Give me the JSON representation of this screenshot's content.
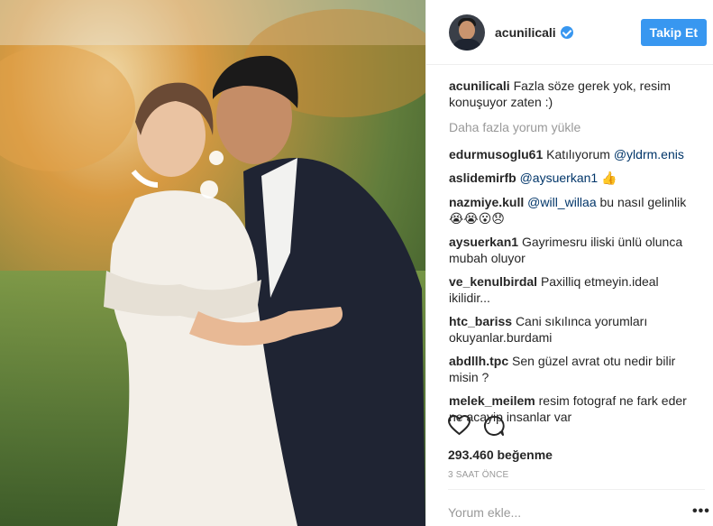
{
  "post": {
    "photo_alt": "Couple photo",
    "author": "acunilicali",
    "follow_label": "Takip Et",
    "caption_user": "acunilicali",
    "caption_text": "Fazla söze gerek yok, resim konuşuyor zaten :)",
    "load_more": "Daha fazla yorum yükle",
    "comments": [
      {
        "user": "edurmusoglu61",
        "text": "Katılıyorum ",
        "mention": "@yldrm.enis",
        "emoji": ""
      },
      {
        "user": "aslidemirfb",
        "text": "",
        "mention": "@aysuerkan1",
        "emoji": " 👍"
      },
      {
        "user": "nazmiye.kull",
        "text": "",
        "mention": "@will_willaa",
        "emoji": "",
        "after": " bu nasıl gelinlik 😭😭😮😞"
      },
      {
        "user": "aysuerkan1",
        "text": "Gayrimesru iliski ünlü olunca mubah oluyor",
        "mention": "",
        "emoji": ""
      },
      {
        "user": "ve_kenulbirdal",
        "text": "Paxilliq etmeyin.ideal ikilidir...",
        "mention": "",
        "emoji": ""
      },
      {
        "user": "htc_bariss",
        "text": "Cani sıkılınca yorumları okuyanlar.burdami",
        "mention": "",
        "emoji": ""
      },
      {
        "user": "abdllh.tpc",
        "text": "Sen güzel avrat otu nedir bilir misin ?",
        "mention": "",
        "emoji": ""
      },
      {
        "user": "melek_meilem",
        "text": "resim fotograf ne fark eder ne acayip insanlar var",
        "mention": "",
        "emoji": ""
      }
    ],
    "likes": "293.460 beğenme",
    "time": "3 SAAT ÖNCE",
    "add_comment_placeholder": "Yorum ekle...",
    "more_options": "•••"
  },
  "icons": {
    "like": "heart-icon",
    "comment": "comment-icon",
    "verified": "verified-badge-icon",
    "options": "more-options-icon"
  },
  "colors": {
    "accent": "#3897f0",
    "mention": "#003569",
    "muted": "#999999",
    "text": "#262626"
  }
}
